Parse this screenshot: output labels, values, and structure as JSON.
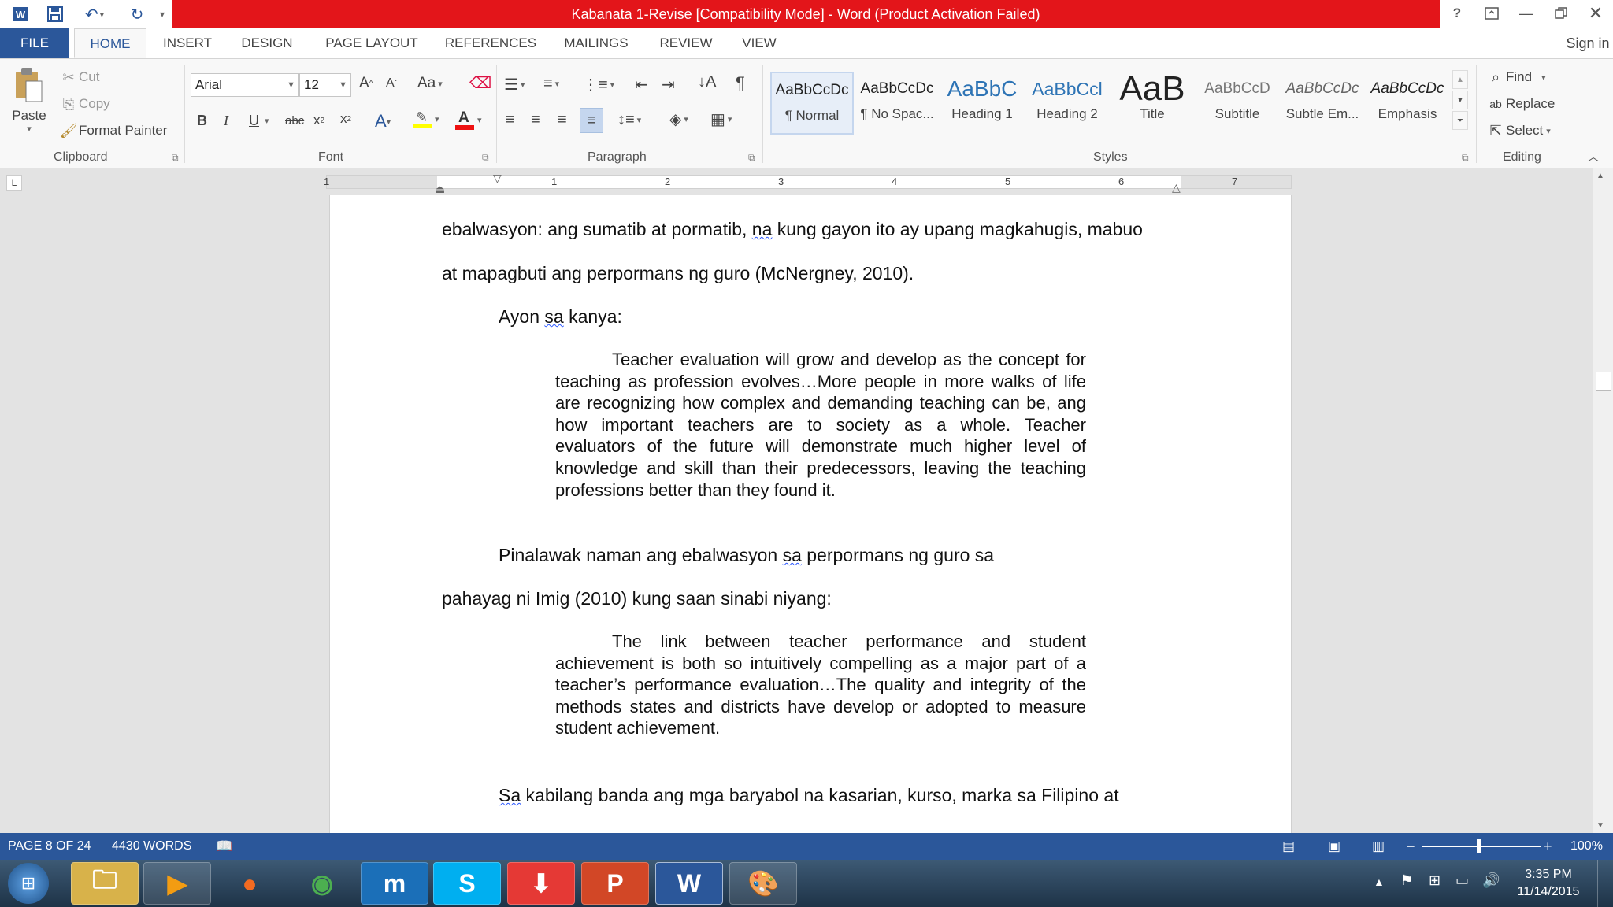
{
  "window": {
    "title": "Kabanata 1-Revise [Compatibility Mode] - Word (Product Activation Failed)",
    "sign_in": "Sign in",
    "title_bar_color": "#e3151a"
  },
  "tabs": [
    "FILE",
    "HOME",
    "INSERT",
    "DESIGN",
    "PAGE LAYOUT",
    "REFERENCES",
    "MAILINGS",
    "REVIEW",
    "VIEW"
  ],
  "active_tab": "HOME",
  "clipboard": {
    "paste": "Paste",
    "cut": "Cut",
    "copy": "Copy",
    "format_painter": "Format Painter",
    "label": "Clipboard"
  },
  "font": {
    "name": "Arial",
    "size": "12",
    "label": "Font",
    "case_btn": "Aa",
    "bold": "B",
    "italic": "I",
    "underline": "U",
    "strike": "abc"
  },
  "paragraph": {
    "label": "Paragraph"
  },
  "styles": {
    "label": "Styles",
    "items": [
      {
        "preview": "AaBbCcDc",
        "name": "¶ Normal"
      },
      {
        "preview": "AaBbCcDc",
        "name": "¶ No Spac..."
      },
      {
        "preview": "AaBbC",
        "name": "Heading 1"
      },
      {
        "preview": "AaBbCcl",
        "name": "Heading 2"
      },
      {
        "preview": "AaB",
        "name": "Title"
      },
      {
        "preview": "AaBbCcD",
        "name": "Subtitle"
      },
      {
        "preview": "AaBbCcDc",
        "name": "Subtle Em..."
      },
      {
        "preview": "AaBbCcDc",
        "name": "Emphasis"
      }
    ]
  },
  "editing": {
    "find": "Find",
    "replace": "Replace",
    "select": "Select",
    "label": "Editing"
  },
  "ruler": [
    "1",
    "1",
    "2",
    "3",
    "4",
    "5",
    "6",
    "7"
  ],
  "document": {
    "line1": {
      "before": "ebalwasyon: ang sumatib at pormatib, ",
      "sq": "na",
      "after": " kung gayon ito ay upang magkahugis, mabuo"
    },
    "line2": "at mapagbuti ang perpormans ng guro (McNergney, 2010).",
    "line3": {
      "before": "Ayon ",
      "sq": "sa",
      "after": " kanya:"
    },
    "quote1": "Teacher evaluation will grow and develop as the concept for teaching as profession evolves…More people in more walks of life are recognizing how complex and demanding teaching can be, ang how important teachers are to society as a whole. Teacher evaluators of the future will demonstrate much higher level of knowledge and skill than their predecessors, leaving the teaching professions better than they found it.",
    "line4": {
      "before": "Pinalawak naman ang ebalwasyon ",
      "sq": "sa",
      "after": " perpormans ng guro sa"
    },
    "line5": "pahayag ni Imig (2010) kung saan sinabi niyang:",
    "quote2": "The link between teacher performance and student achievement is both so intuitively compelling as a major part of a teacher’s performance evaluation…The quality and integrity of the methods states and districts have develop or adopted to measure student achievement.",
    "line6": {
      "sq": "Sa",
      "after": " kabilang banda ang mga baryabol na kasarian, kurso, marka sa Filipino at"
    }
  },
  "status": {
    "page": "PAGE 8 OF 24",
    "words": "4430 WORDS",
    "zoom": "100%",
    "bar_color": "#2b579a"
  },
  "taskbar": {
    "time": "3:35 PM",
    "date": "11/14/2015"
  }
}
